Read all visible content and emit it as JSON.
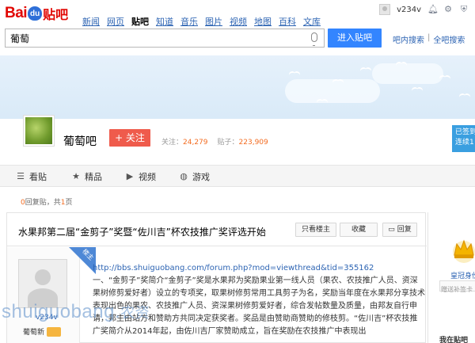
{
  "logo": {
    "bai": "Bai",
    "du": "du",
    "tieba": "贴吧"
  },
  "nav": {
    "links": [
      "新闻",
      "网页",
      "贴吧",
      "知道",
      "音乐",
      "图片",
      "视频",
      "地图",
      "百科",
      "文库"
    ],
    "active_index": 2
  },
  "user": {
    "name": "v234v"
  },
  "search": {
    "value": "葡萄",
    "button": "进入贴吧",
    "link1": "吧内搜索",
    "sep": "|",
    "link2": "全吧搜索"
  },
  "forum": {
    "name": "葡萄吧",
    "follow_label": "+ 关注",
    "follow_count_label": "关注：",
    "follow_count": "24,279",
    "post_count_label": "贴子：",
    "post_count": "223,909",
    "sign_line1": "已签到",
    "sign_line2": "连续1"
  },
  "tabs": [
    {
      "label": "看贴",
      "icon": "list-icon"
    },
    {
      "label": "精品",
      "icon": "star-icon"
    },
    {
      "label": "视频",
      "icon": "video-icon"
    },
    {
      "label": "游戏",
      "icon": "gamepad-icon"
    }
  ],
  "pager": {
    "replies": "0",
    "replies_label": "回复贴，共",
    "pages": "1",
    "pages_label": "页"
  },
  "thread": {
    "title": "水果邦第二届“金剪子”奖暨“佐川吉”杯农技推广奖评选开始",
    "btn_only_op": "只看楼主",
    "btn_favorite": "收藏",
    "btn_reply": "回复",
    "badge": "楼主",
    "link": "http://bbs.shuiguobang.com/forum.php?mod=viewthread&tid=355162",
    "paragraph1": "一、“金剪子”奖简介“金剪子”奖是水果邦为奖励果业第一线人员（果农、农技推广人员、资深果树修剪爱好者）设立的专项奖，取果树修剪常用工具剪子为名，奖励当年度在水果邦分享技术表现出色的果农、农技推广人员、资深果树修剪爱好者，综合发帖数量及质量，由邦友自行申请，邦主由站方和赞助方共同决定获奖者。奖品是由赞助商赞助的修枝剪。“佐川吉”杯农技推广奖简介从2014年起，由佐川吉厂家赞助成立，旨在奖励在农技推广中表现出",
    "poster_name": "v234v",
    "poster_level": "葡萄新"
  },
  "sidebar": {
    "crown_label": "皇冠身份",
    "gift_hint": "赠送补签卡",
    "my_forum": "我在贴吧"
  },
  "watermark": {
    "latin": "shuiguobang",
    "dot": ".",
    "cn": "农资"
  }
}
